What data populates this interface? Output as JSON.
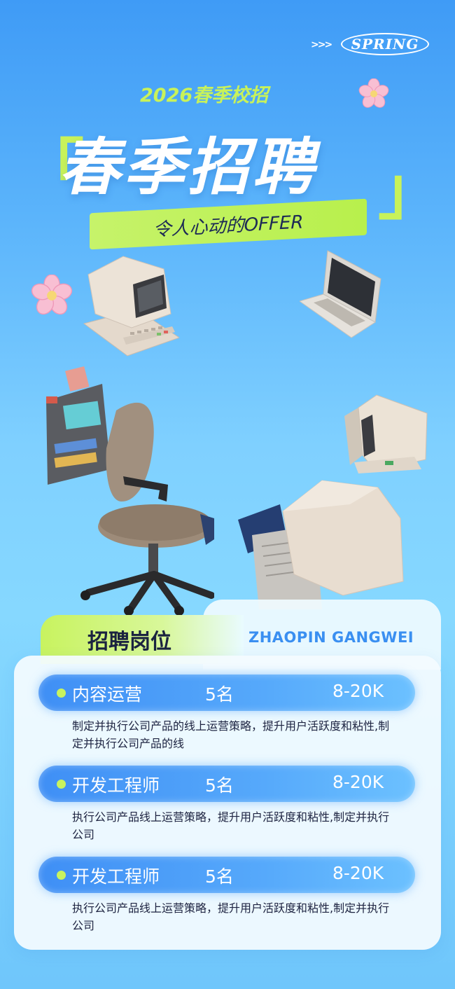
{
  "brand": {
    "arrows": ">>>",
    "badge": "SPRING"
  },
  "header": {
    "subtitle": "2026春季校招",
    "title": "春季招聘",
    "bracket_left": "「",
    "bracket_right": "」",
    "tagline": "令人心动的OFFER"
  },
  "section": {
    "tab_label": "招聘岗位",
    "pinyin": "ZHAOPIN GANGWEI"
  },
  "jobs": [
    {
      "title": "内容运营",
      "count": "5名",
      "salary": "8-20K",
      "description": "制定并执行公司产品的线上运营策略，提升用户活跃度和粘性,制定并执行公司产品的线"
    },
    {
      "title": "开发工程师",
      "count": "5名",
      "salary": "8-20K",
      "description": "执行公司产品线上运营策略，提升用户活跃度和粘性,制定并执行公司"
    },
    {
      "title": "开发工程师",
      "count": "5名",
      "salary": "8-20K",
      "description": "执行公司产品线上运营策略，提升用户活跃度和粘性,制定并执行公司"
    }
  ],
  "colors": {
    "accent_green": "#c8f35f",
    "accent_blue": "#3f8ff5",
    "text_dark": "#1b2340"
  }
}
